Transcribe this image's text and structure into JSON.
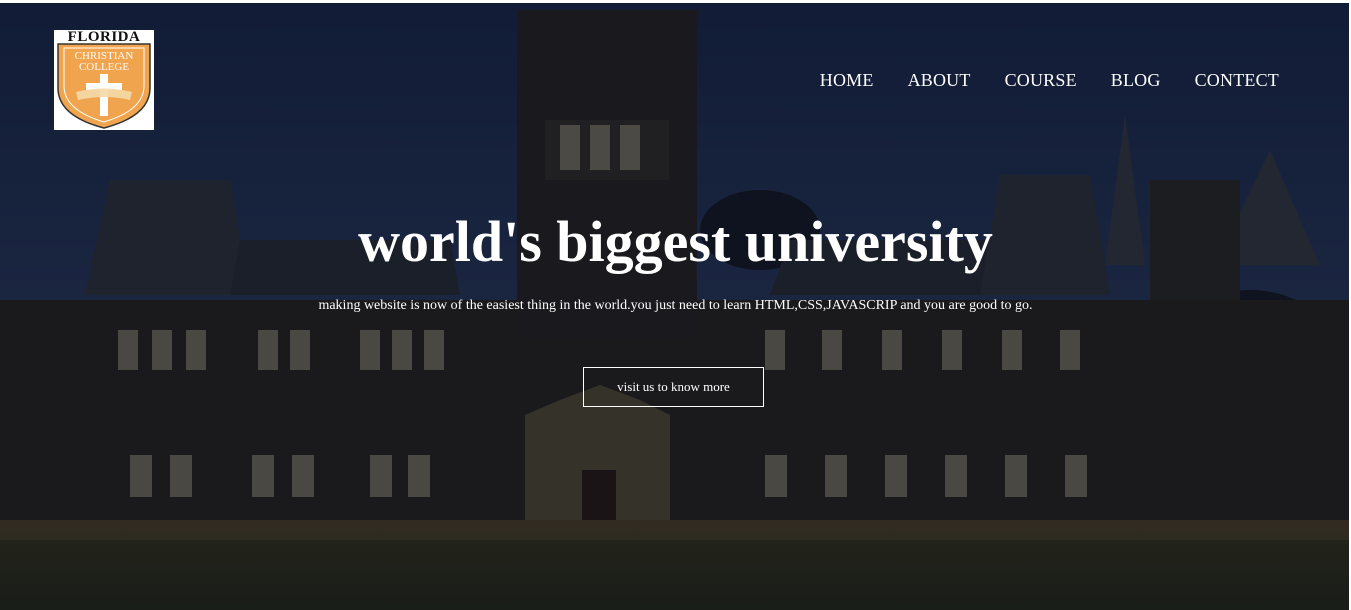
{
  "header": {
    "logo": {
      "line1": "FLORIDA",
      "line2": "CHRISTIAN",
      "line3": "COLLEGE",
      "shield_color": "#e8953a",
      "icon": "cross-shield-icon"
    },
    "nav": [
      {
        "label": "HOME"
      },
      {
        "label": "ABOUT"
      },
      {
        "label": "COURSE"
      },
      {
        "label": "BLOG"
      },
      {
        "label": "CONTECT"
      }
    ]
  },
  "hero": {
    "title": "world's biggest university",
    "subtitle": "making website is now of the easiest thing in the world.you just need to learn HTML,CSS,JAVASCRIP and you are good to go.",
    "cta_label": "visit us to know more",
    "background_image": "university-building-photo",
    "colors": {
      "sky": "#243354",
      "stone": "#2a2620",
      "grass": "#4a4a22",
      "text": "#ffffff"
    }
  }
}
